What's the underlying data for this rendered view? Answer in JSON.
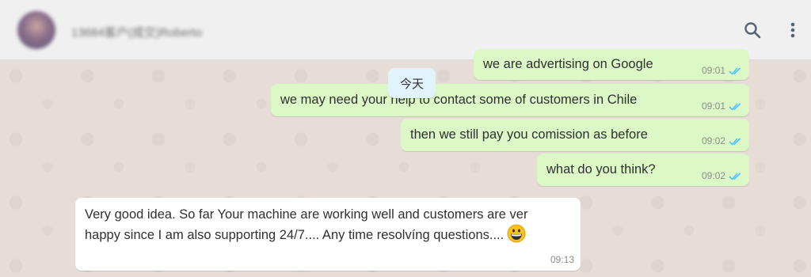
{
  "header": {
    "contact_name": "13684客户(成交)Roberto",
    "search_icon": "search-icon",
    "menu_icon": "more-vertical-icon"
  },
  "date_chip": "今天",
  "messages": [
    {
      "text": "we are advertising on Google",
      "time": "09:01",
      "direction": "outgoing",
      "status": "read"
    },
    {
      "text": "we may need your help to contact some of customers in Chile",
      "time": "09:01",
      "direction": "outgoing",
      "status": "read"
    },
    {
      "text": "then we still pay you comission as before",
      "time": "09:02",
      "direction": "outgoing",
      "status": "read"
    },
    {
      "text": "what do you think?",
      "time": "09:02",
      "direction": "outgoing",
      "status": "read"
    },
    {
      "line1": "Very good idea. So far Your machine are working well and customers are ver",
      "line2": "happy since I am also supporting 24/7.... Any time resolvíng questions....",
      "time": "09:13",
      "direction": "incoming",
      "emoji": "grinning-face"
    }
  ],
  "colors": {
    "outgoing_bubble": "#dcf8c6",
    "incoming_bubble": "#ffffff",
    "read_ticks": "#4fc3f7",
    "header_bg": "#f0f0f0",
    "chat_bg": "#e6ded6"
  }
}
